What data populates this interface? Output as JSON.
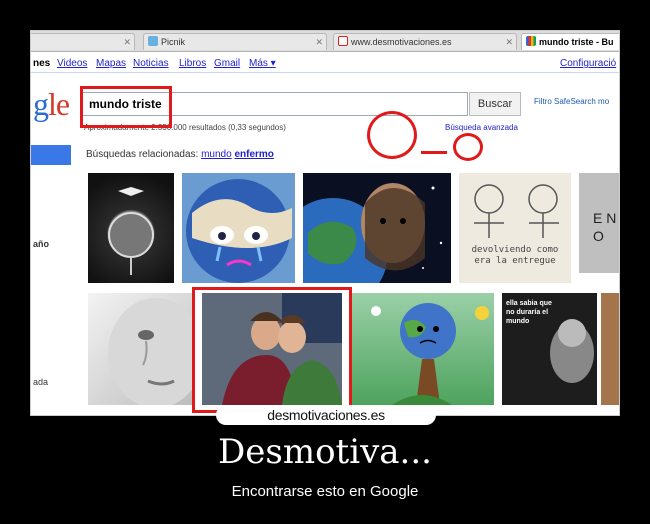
{
  "browser": {
    "tabs": [
      {
        "label": "",
        "active": false
      },
      {
        "label": "Picnik",
        "active": false
      },
      {
        "label": "www.desmotivaciones.es",
        "active": false
      },
      {
        "label": "mundo triste - Bu",
        "active": true
      }
    ]
  },
  "google": {
    "nav": {
      "current": "nes",
      "links": [
        "Videos",
        "Mapas",
        "Noticias",
        "Libros",
        "Gmail",
        "Más ▾"
      ],
      "settings": "Configuració"
    },
    "logo": {
      "g": "g",
      "l": "l",
      "e": "e"
    },
    "search": {
      "value": "mundo triste",
      "button": "Buscar"
    },
    "safesearch": "Filtro SafeSearch mo",
    "results_count": "Aproximadamente 2.330.000 resultados (0,33 segundos)",
    "advanced": "Búsqueda avanzada",
    "related": {
      "prefix": "Búsquedas relacionadas:",
      "word1": "mundo",
      "word2": "enfermo"
    },
    "left_rail": {
      "label1": "año",
      "label2": "ada"
    }
  },
  "thumbs": {
    "drawing_text": "devolviendo como era la entregue",
    "sign_text": "E NO",
    "poster_text": "ella sabia que no duraría el mundo"
  },
  "watermark": "desmotivaciones.es",
  "caption": {
    "title": "Desmotiva...",
    "subtitle": "Encontrarse esto en Google"
  },
  "colors": {
    "annotation": "#e0191b",
    "link": "#2222cc",
    "google_blue": "#2a6bd2"
  }
}
